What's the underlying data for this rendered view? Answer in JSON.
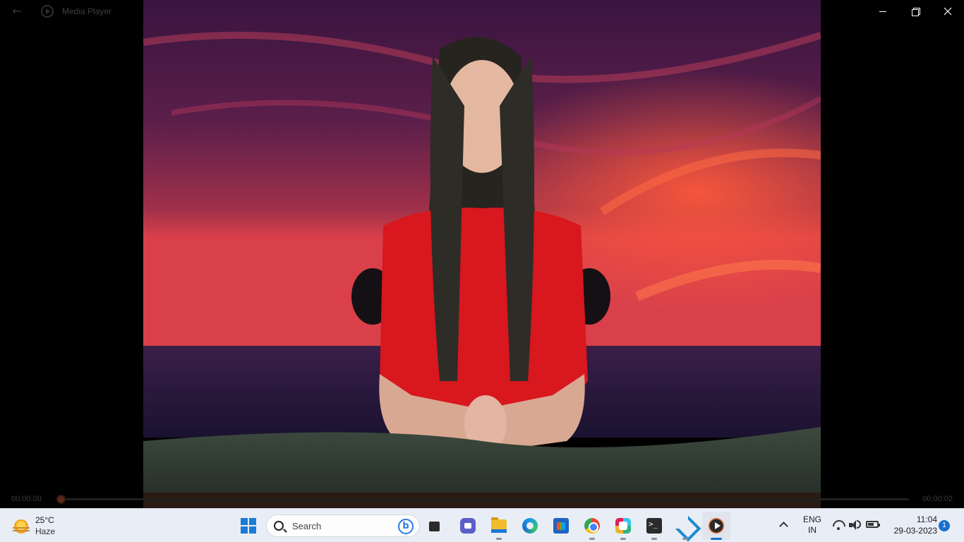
{
  "window": {
    "title": "Media Player",
    "controls": {
      "minimize": "minimize",
      "maximize": "restore",
      "close": "close"
    }
  },
  "playback": {
    "elapsed": "00:00:00",
    "total": "00:00:02",
    "progress_fraction": 0.0
  },
  "taskbar": {
    "weather": {
      "temp": "25°C",
      "condition": "Haze",
      "icon": "sun-haze-icon"
    },
    "search_placeholder": "Search",
    "apps": [
      {
        "name": "task-view",
        "icon": "task-view-icon"
      },
      {
        "name": "teams",
        "icon": "teams-icon"
      },
      {
        "name": "file-explorer",
        "icon": "folder-icon"
      },
      {
        "name": "edge",
        "icon": "edge-icon"
      },
      {
        "name": "store",
        "icon": "store-icon"
      },
      {
        "name": "chrome",
        "icon": "chrome-icon"
      },
      {
        "name": "slack",
        "icon": "slack-icon"
      },
      {
        "name": "terminal",
        "icon": "terminal-icon"
      },
      {
        "name": "vscode",
        "icon": "vscode-icon"
      },
      {
        "name": "media-player",
        "icon": "media-player-icon",
        "active": true
      }
    ],
    "tray": {
      "lang_line1": "ENG",
      "lang_line2": "IN",
      "time": "11:04",
      "date": "29-03-2023",
      "notifications": "1"
    }
  },
  "colors": {
    "accent": "#1a6fd0",
    "seek_fill": "#6a2a14",
    "taskbar_bg": "#e9eef6"
  }
}
